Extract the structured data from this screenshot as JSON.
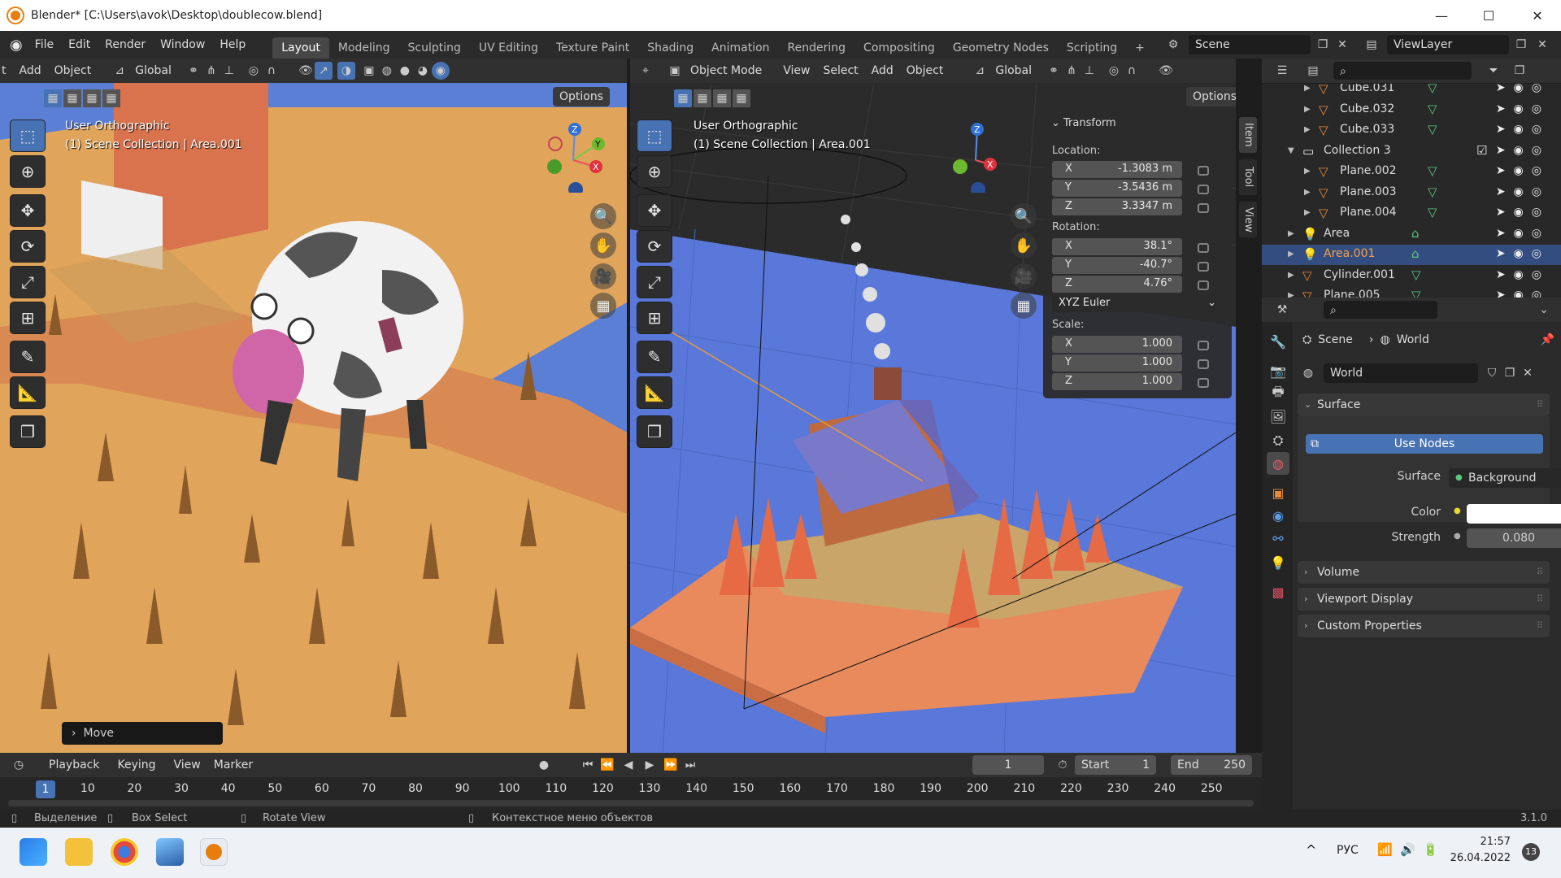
{
  "window": {
    "title": "Blender* [C:\\Users\\avok\\Desktop\\doublecow.blend]",
    "min": "—",
    "max": "☐",
    "close": "✕"
  },
  "menus": [
    "File",
    "Edit",
    "Render",
    "Window",
    "Help"
  ],
  "workspaces": [
    "Layout",
    "Modeling",
    "Sculpting",
    "UV Editing",
    "Texture Paint",
    "Shading",
    "Animation",
    "Rendering",
    "Compositing",
    "Geometry Nodes",
    "Scripting"
  ],
  "active_workspace": "Layout",
  "add_workspace": "+",
  "scene": {
    "name": "Scene",
    "view_layer": "ViewLayer"
  },
  "viewport_left": {
    "header_items": [
      "t",
      "Add",
      "Object"
    ],
    "orientation": "Global",
    "options": "Options",
    "info_line1": "User Orthographic",
    "info_line2": "(1) Scene Collection | Area.001",
    "last_op": "Move"
  },
  "viewport_right": {
    "mode": "Object Mode",
    "header_items": [
      "View",
      "Select",
      "Add",
      "Object"
    ],
    "orientation": "Global",
    "options": "Options",
    "info_line1": "User Orthographic",
    "info_line2": "(1) Scene Collection | Area.001",
    "side_tabs": [
      "Item",
      "Tool",
      "View"
    ]
  },
  "transform": {
    "title": "Transform",
    "location_label": "Location:",
    "location": [
      {
        "axis": "X",
        "value": "-1.3083 m"
      },
      {
        "axis": "Y",
        "value": "-3.5436 m"
      },
      {
        "axis": "Z",
        "value": "3.3347 m"
      }
    ],
    "rotation_label": "Rotation:",
    "rotation": [
      {
        "axis": "X",
        "value": "38.1°"
      },
      {
        "axis": "Y",
        "value": "-40.7°"
      },
      {
        "axis": "Z",
        "value": "4.76°"
      }
    ],
    "rotation_mode": "XYZ Euler",
    "scale_label": "Scale:",
    "scale": [
      {
        "axis": "X",
        "value": "1.000"
      },
      {
        "axis": "Y",
        "value": "1.000"
      },
      {
        "axis": "Z",
        "value": "1.000"
      }
    ]
  },
  "outliner": {
    "rows": [
      {
        "name": "Cube.031",
        "type": "mesh",
        "indent": 2
      },
      {
        "name": "Cube.032",
        "type": "mesh",
        "indent": 2
      },
      {
        "name": "Cube.033",
        "type": "mesh",
        "indent": 2
      },
      {
        "name": "Collection 3",
        "type": "collection",
        "indent": 1
      },
      {
        "name": "Plane.002",
        "type": "mesh",
        "indent": 2
      },
      {
        "name": "Plane.003",
        "type": "mesh",
        "indent": 2
      },
      {
        "name": "Plane.004",
        "type": "mesh",
        "indent": 2
      },
      {
        "name": "Area",
        "type": "light",
        "indent": 1
      },
      {
        "name": "Area.001",
        "type": "light",
        "indent": 1,
        "selected": true
      },
      {
        "name": "Cylinder.001",
        "type": "mesh",
        "indent": 1
      },
      {
        "name": "Plane.005",
        "type": "mesh",
        "indent": 1
      }
    ]
  },
  "properties": {
    "breadcrumb_scene": "Scene",
    "breadcrumb_world": "World",
    "world_name": "World",
    "surface_section": "Surface",
    "use_nodes": "Use Nodes",
    "surface_label": "Surface",
    "surface_value": "Background",
    "color_label": "Color",
    "color_value": "#ffffff",
    "strength_label": "Strength",
    "strength_value": "0.080",
    "sections": [
      "Volume",
      "Viewport Display",
      "Custom Properties"
    ]
  },
  "timeline": {
    "menus": [
      "Playback",
      "Keying",
      "View",
      "Marker"
    ],
    "current_frame": "1",
    "start_label": "Start",
    "start": "1",
    "end_label": "End",
    "end": "250",
    "ticks": [
      10,
      20,
      30,
      40,
      50,
      60,
      70,
      80,
      90,
      100,
      110,
      120,
      130,
      140,
      150,
      160,
      170,
      180,
      190,
      200,
      210,
      220,
      230,
      240,
      250
    ]
  },
  "statusbar": {
    "select": "Выделение",
    "box_select": "Box Select",
    "rotate_view": "Rotate View",
    "context_menu": "Контекстное меню объектов",
    "version": "3.1.0"
  },
  "taskbar": {
    "lang": "РУС",
    "time": "21:57",
    "date": "26.04.2022",
    "notif": "13"
  },
  "colors": {
    "accent": "#4772b3",
    "selected_row": "#334d80",
    "blender_orange": "#e87d0d",
    "mesh_green": "#5ec77e"
  }
}
